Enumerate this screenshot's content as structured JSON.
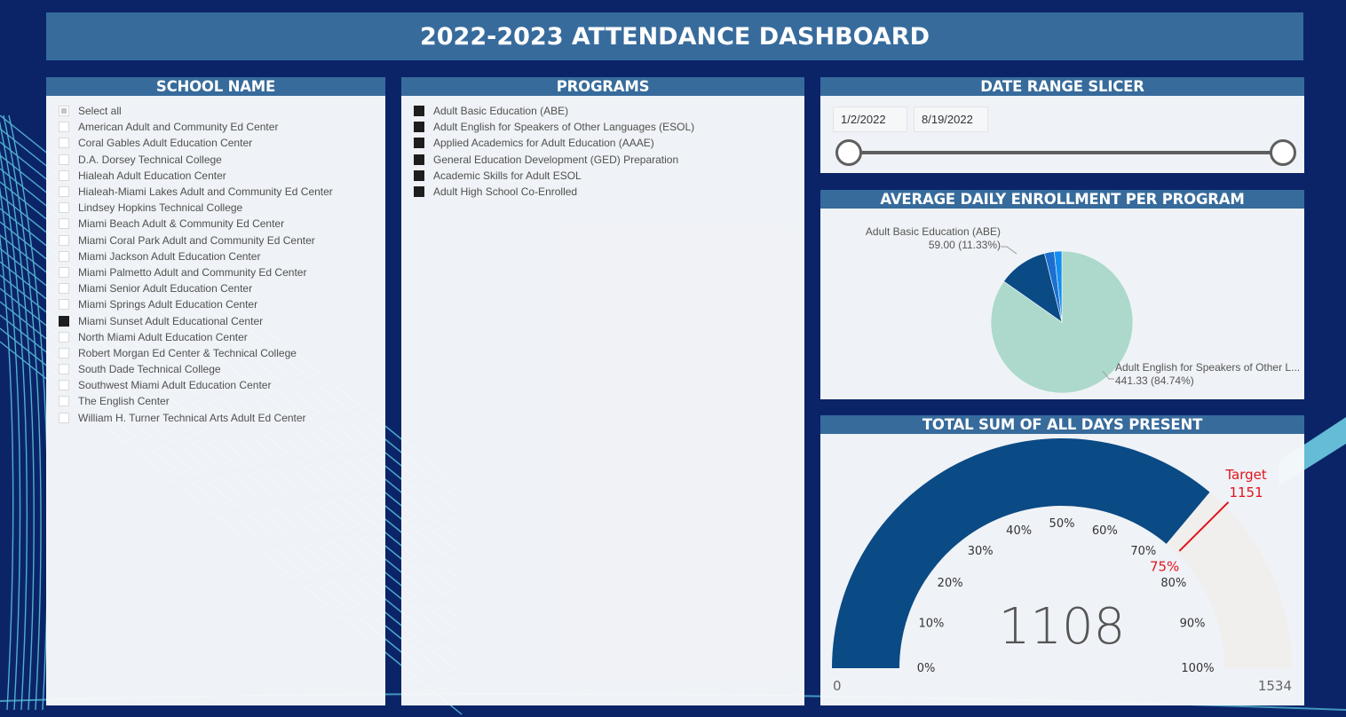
{
  "title": "2022-2023 ATTENDANCE DASHBOARD",
  "colors": {
    "background": "#0b2468",
    "header": "#376b9c",
    "panel": "#f7f9fb",
    "gauge_fill": "#0a4a85",
    "gauge_track": "#f1efed",
    "target": "#e0141e",
    "pie_esol": "#acd9cb",
    "pie_abe": "#0a4a85",
    "pie_third": "#1a6fd0",
    "pie_fourth": "#118ef0"
  },
  "school_slicer": {
    "header": "SCHOOL NAME",
    "items": [
      {
        "label": "Select all",
        "state": "partial"
      },
      {
        "label": "American Adult and Community Ed Center",
        "state": "unchecked"
      },
      {
        "label": "Coral Gables Adult Education Center",
        "state": "unchecked"
      },
      {
        "label": "D.A. Dorsey Technical College",
        "state": "unchecked"
      },
      {
        "label": "Hialeah Adult Education Center",
        "state": "unchecked"
      },
      {
        "label": "Hialeah-Miami Lakes Adult and Community Ed Center",
        "state": "unchecked"
      },
      {
        "label": "Lindsey Hopkins Technical College",
        "state": "unchecked"
      },
      {
        "label": "Miami Beach Adult & Community Ed Center",
        "state": "unchecked"
      },
      {
        "label": "Miami Coral Park Adult and Community Ed Center",
        "state": "unchecked"
      },
      {
        "label": "Miami Jackson Adult Education Center",
        "state": "unchecked"
      },
      {
        "label": "Miami Palmetto Adult and Community Ed Center",
        "state": "unchecked"
      },
      {
        "label": "Miami Senior Adult Education Center",
        "state": "unchecked"
      },
      {
        "label": "Miami Springs Adult Education Center",
        "state": "unchecked"
      },
      {
        "label": "Miami Sunset Adult Educational Center",
        "state": "checked"
      },
      {
        "label": "North Miami Adult Education Center",
        "state": "unchecked"
      },
      {
        "label": "Robert Morgan Ed Center & Technical College",
        "state": "unchecked"
      },
      {
        "label": "South Dade Technical College",
        "state": "unchecked"
      },
      {
        "label": "Southwest Miami Adult Education Center",
        "state": "unchecked"
      },
      {
        "label": "The English Center",
        "state": "unchecked"
      },
      {
        "label": "William H. Turner Technical Arts Adult Ed Center",
        "state": "unchecked"
      }
    ]
  },
  "program_slicer": {
    "header": "PROGRAMS",
    "items": [
      {
        "label": "Adult Basic Education (ABE)",
        "state": "checked"
      },
      {
        "label": "Adult English for Speakers of Other Languages (ESOL)",
        "state": "checked"
      },
      {
        "label": "Applied Academics for Adult Education (AAAE)",
        "state": "checked"
      },
      {
        "label": "General Education Development (GED) Preparation",
        "state": "checked"
      },
      {
        "label": "Academic Skills for Adult ESOL",
        "state": "checked"
      },
      {
        "label": "Adult High School Co-Enrolled",
        "state": "checked"
      }
    ]
  },
  "date_slicer": {
    "header": "DATE RANGE SLICER",
    "start": "1/2/2022",
    "end": "8/19/2022",
    "range_start_fraction": 0,
    "range_end_fraction": 1
  },
  "chart_data": [
    {
      "type": "pie",
      "title": "AVERAGE DAILY ENROLLMENT PER PROGRAM",
      "start_angle_deg": 0,
      "direction": "clockwise",
      "slices": [
        {
          "name": "Adult English for Speakers of Other Languages (ESOL)",
          "value": 441.33,
          "percent": 84.74,
          "label_line1": "Adult English for Speakers of Other L...",
          "label_line2": "441.33 (84.74%)",
          "color_key": "pie_esol"
        },
        {
          "name": "Adult Basic Education (ABE)",
          "value": 59.0,
          "percent": 11.33,
          "label_line1": "Adult Basic Education (ABE)",
          "label_line2": "59.00 (11.33%)",
          "color_key": "pie_abe"
        },
        {
          "name": "(unlabeled slice 3)",
          "value": 11.5,
          "percent": 2.21,
          "label_line1": null,
          "label_line2": null,
          "color_key": "pie_third"
        },
        {
          "name": "(unlabeled slice 4)",
          "value": 8.97,
          "percent": 1.72,
          "label_line1": null,
          "label_line2": null,
          "color_key": "pie_fourth"
        }
      ]
    },
    {
      "type": "gauge",
      "title": "TOTAL SUM OF ALL DAYS PRESENT",
      "value": 1108,
      "value_label": "1108",
      "min": 0,
      "max": 1534,
      "min_label": "0",
      "max_label": "1534",
      "target": 1151,
      "target_title": "Target",
      "target_label": "1151",
      "target_percent_label": "75%",
      "tick_labels": [
        "0%",
        "10%",
        "20%",
        "30%",
        "40%",
        "50%",
        "60%",
        "70%",
        "80%",
        "90%",
        "100%"
      ]
    }
  ]
}
